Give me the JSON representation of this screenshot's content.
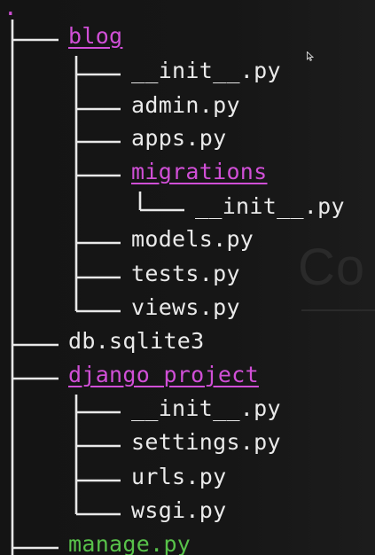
{
  "tree": {
    "root": ".",
    "entries": [
      {
        "label": "blog",
        "kind": "dir",
        "depth": 1
      },
      {
        "label": "__init__.py",
        "kind": "file",
        "depth": 2
      },
      {
        "label": "admin.py",
        "kind": "file",
        "depth": 2
      },
      {
        "label": "apps.py",
        "kind": "file",
        "depth": 2
      },
      {
        "label": "migrations",
        "kind": "dir",
        "depth": 2
      },
      {
        "label": "__init__.py",
        "kind": "file",
        "depth": 3
      },
      {
        "label": "models.py",
        "kind": "file",
        "depth": 2
      },
      {
        "label": "tests.py",
        "kind": "file",
        "depth": 2
      },
      {
        "label": "views.py",
        "kind": "file",
        "depth": 2
      },
      {
        "label": "db.sqlite3",
        "kind": "file",
        "depth": 1
      },
      {
        "label": "django_project",
        "kind": "dir",
        "depth": 1
      },
      {
        "label": "__init__.py",
        "kind": "file",
        "depth": 2
      },
      {
        "label": "settings.py",
        "kind": "file",
        "depth": 2
      },
      {
        "label": "urls.py",
        "kind": "file",
        "depth": 2
      },
      {
        "label": "wsgi.py",
        "kind": "file",
        "depth": 2
      },
      {
        "label": "manage.py",
        "kind": "exec",
        "depth": 1
      }
    ]
  },
  "background_text": "Co",
  "colors": {
    "background": "#141414",
    "tree_lines": "#e8e8e8",
    "file_text": "#eaeaea",
    "directory": "#d04fd6",
    "executable": "#58c24a"
  },
  "icons": {
    "pointer": "mouse-cursor-icon"
  }
}
